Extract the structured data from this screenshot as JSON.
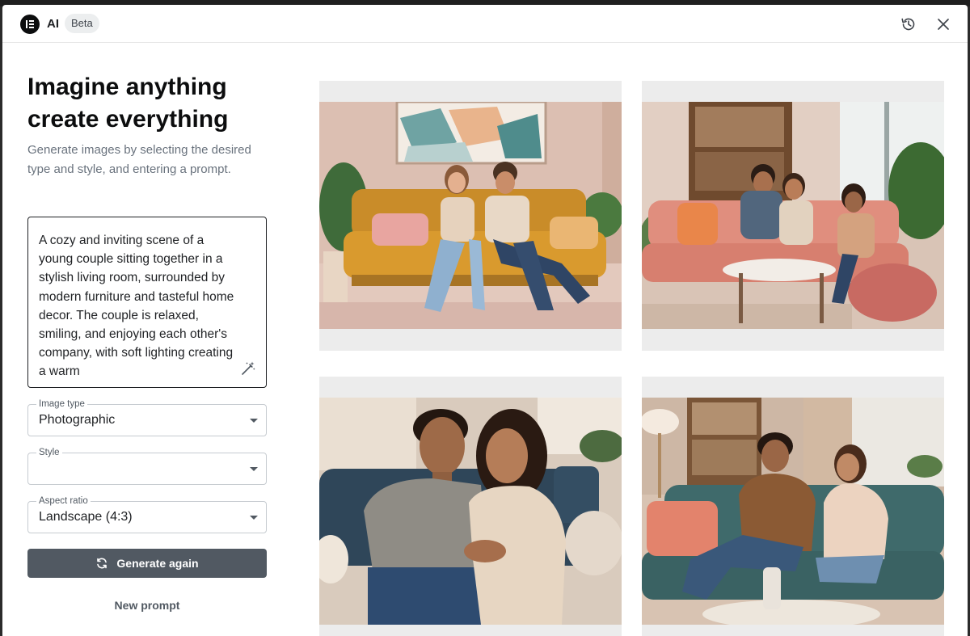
{
  "header": {
    "app_name": "AI",
    "badge": "Beta",
    "history_icon": "history-icon",
    "close_icon": "close-icon"
  },
  "intro": {
    "headline": "Imagine anything create everything",
    "description": "Generate images by selecting the desired type and style, and entering a prompt."
  },
  "prompt": {
    "text": "A cozy and inviting scene of a young couple sitting together in a stylish living room, surrounded by modern furniture and tasteful home decor. The couple is relaxed, smiling, and enjoying each other's company, with soft lighting creating a warm",
    "enhance_icon": "magic-wand-icon"
  },
  "fields": {
    "image_type": {
      "label": "Image type",
      "value": "Photographic"
    },
    "style": {
      "label": "Style",
      "value": ""
    },
    "aspect_ratio": {
      "label": "Aspect ratio",
      "value": "Landscape (4:3)"
    }
  },
  "actions": {
    "generate_again": "Generate again",
    "new_prompt": "New prompt"
  },
  "results": {
    "images": [
      {
        "name": "couple-on-mustard-sofa"
      },
      {
        "name": "three-friends-on-pink-sofa"
      },
      {
        "name": "couple-close-up-on-blue-sofa"
      },
      {
        "name": "couple-on-teal-sofa"
      }
    ]
  },
  "colors": {
    "primary_button": "#515962",
    "text_dark": "#0c0d0e",
    "text_muted": "#69727d",
    "tile_bg": "#ececec"
  }
}
